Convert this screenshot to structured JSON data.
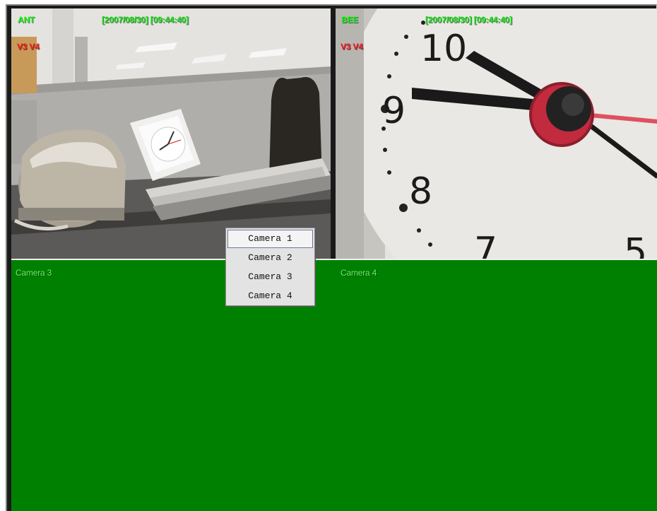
{
  "panes": [
    {
      "camera_name": "ANT",
      "timestamp": "[2007/08/30] [09:44:40]",
      "tags": "V3 V4"
    },
    {
      "camera_name": "BEE",
      "timestamp": "[2007/08/30] [09:44:40]",
      "tags": "V3 V4"
    },
    {
      "label": "Camera 3"
    },
    {
      "label": "Camera 4"
    }
  ],
  "context_menu": {
    "items": [
      "Camera 1",
      "Camera 2",
      "Camera 3",
      "Camera 4"
    ],
    "highlighted": "Camera 1"
  },
  "colors": {
    "empty_channel": "#008000",
    "osd_text": "#12ff12",
    "osd_tags": "#ff1a1a"
  },
  "clock_numerals": [
    "10",
    "9",
    "8",
    "7",
    "5"
  ]
}
